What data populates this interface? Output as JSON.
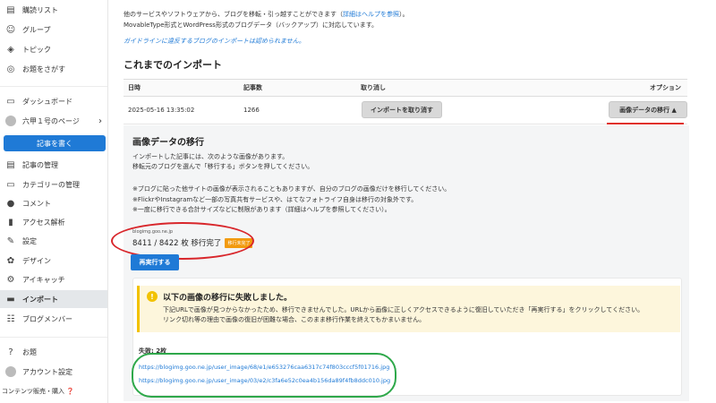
{
  "sidebar": {
    "items": [
      {
        "label": "購読リスト",
        "icon": "book-icon"
      },
      {
        "label": "グループ",
        "icon": "group-icon"
      },
      {
        "label": "トピック",
        "icon": "topic-icon"
      },
      {
        "label": "お題をさがす",
        "icon": "search-theme-icon"
      },
      {
        "label": "ダッシュボード",
        "icon": "dashboard-icon"
      },
      {
        "label": "六甲１号のページ",
        "icon": "avatar"
      },
      {
        "label": "記事の管理",
        "icon": "document-icon"
      },
      {
        "label": "カテゴリーの管理",
        "icon": "folder-icon"
      },
      {
        "label": "コメント",
        "icon": "comment-icon"
      },
      {
        "label": "アクセス解析",
        "icon": "chart-icon"
      },
      {
        "label": "設定",
        "icon": "wrench-icon"
      },
      {
        "label": "デザイン",
        "icon": "palette-icon"
      },
      {
        "label": "アイキャッチ",
        "icon": "image-icon"
      },
      {
        "label": "インポート",
        "icon": "import-icon"
      },
      {
        "label": "ブログメンバー",
        "icon": "members-icon"
      },
      {
        "label": "お題",
        "icon": "question-icon"
      },
      {
        "label": "アカウント設定",
        "icon": "account-avatar"
      }
    ],
    "write_button": "記事を書く",
    "footer": "コンテンツ販売・購入 ❓"
  },
  "intro": {
    "line1_pre": "他のサービスやソフトウェアから、ブログを移転・引っ越すことができます（",
    "line1_link": "詳細はヘルプを参照",
    "line1_post": "）。",
    "line2": "MovableType形式とWordPress形式のブログデータ（バックアップ）に対応しています。",
    "note": "ガイドラインに違反するブログのインポートは認められません。"
  },
  "history": {
    "title": "これまでのインポート",
    "headers": {
      "date": "日時",
      "count": "記事数",
      "cancel": "取り消し",
      "option": "オプション"
    },
    "row": {
      "date": "2025-05-16 13:35:02",
      "count": "1266",
      "cancel_button": "インポートを取り消す",
      "option_button": "画像データの移行 ▲"
    }
  },
  "migration": {
    "title": "画像データの移行",
    "desc1": "インポートした記事には、次のような画像があります。",
    "desc2": "移転元のブログを選んで「移行する」ボタンを押してください。",
    "note1": "※ブログに貼った他サイトの画像が表示されることもありますが、自分のブログの画像だけを移行してください。",
    "note2": "※FlickrやInstagramなど一部の写真共有サービスや、はてなフォトライフ自身は移行の対象外です。",
    "note3": "※一度に移行できる合計サイズなどに制限があります（詳細はヘルプを参照してください）。",
    "source": "blogimg.goo.ne.jp",
    "progress": "8411 / 8422 枚 移行完了",
    "badge": "移行未完了",
    "rerun_button": "再実行する"
  },
  "failure": {
    "title": "以下の画像の移行に失敗しました。",
    "text1": "下記URLで画像が見つからなかったため、移行できませんでした。URLから画像に正しくアクセスできるように復旧していただき「再実行する」をクリックしてください。",
    "text2": "リンク切れ等の理由で画像の復旧が困難な場合、このまま移行作業を終えてもかまいません。",
    "count_label": "失敗: 2枚",
    "links": [
      "https://blogimg.goo.ne.jp/user_image/68/e1/e653276caa6317c74f803cccf5f01716.jpg",
      "https://blogimg.goo.ne.jp/user_image/03/e2/c3fa6e52c0ea4b156da89f4fb8ddc010.jpg"
    ]
  },
  "colors": {
    "accent": "#1f7ad6",
    "badge": "#f29a0e",
    "warning": "#f2c200",
    "annotation_red": "#d8262b",
    "annotation_green": "#2ea84a"
  }
}
